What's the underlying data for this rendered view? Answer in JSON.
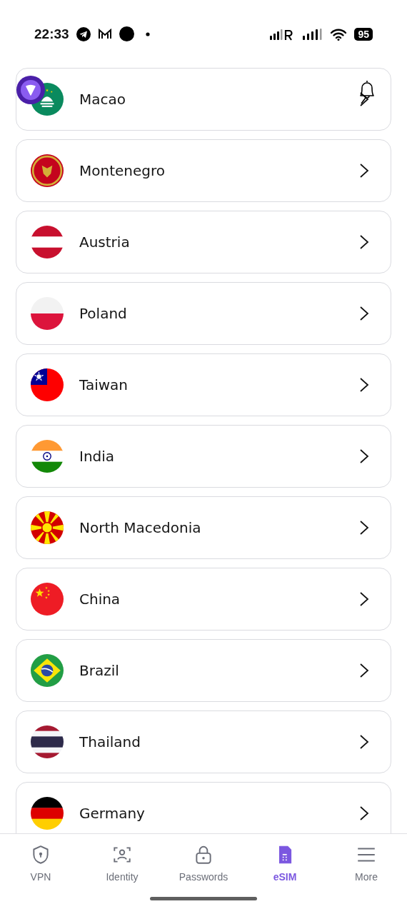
{
  "status_bar": {
    "time": "22:33",
    "battery": "95"
  },
  "countries": [
    {
      "name": "Macao"
    },
    {
      "name": "Montenegro"
    },
    {
      "name": "Austria"
    },
    {
      "name": "Poland"
    },
    {
      "name": "Taiwan"
    },
    {
      "name": "India"
    },
    {
      "name": "North Macedonia"
    },
    {
      "name": "China"
    },
    {
      "name": "Brazil"
    },
    {
      "name": "Thailand"
    },
    {
      "name": "Germany"
    }
  ],
  "bottom_nav": [
    {
      "label": "VPN",
      "selected": false
    },
    {
      "label": "Identity",
      "selected": false
    },
    {
      "label": "Passwords",
      "selected": false
    },
    {
      "label": "eSIM",
      "selected": true
    },
    {
      "label": "More",
      "selected": false
    }
  ]
}
